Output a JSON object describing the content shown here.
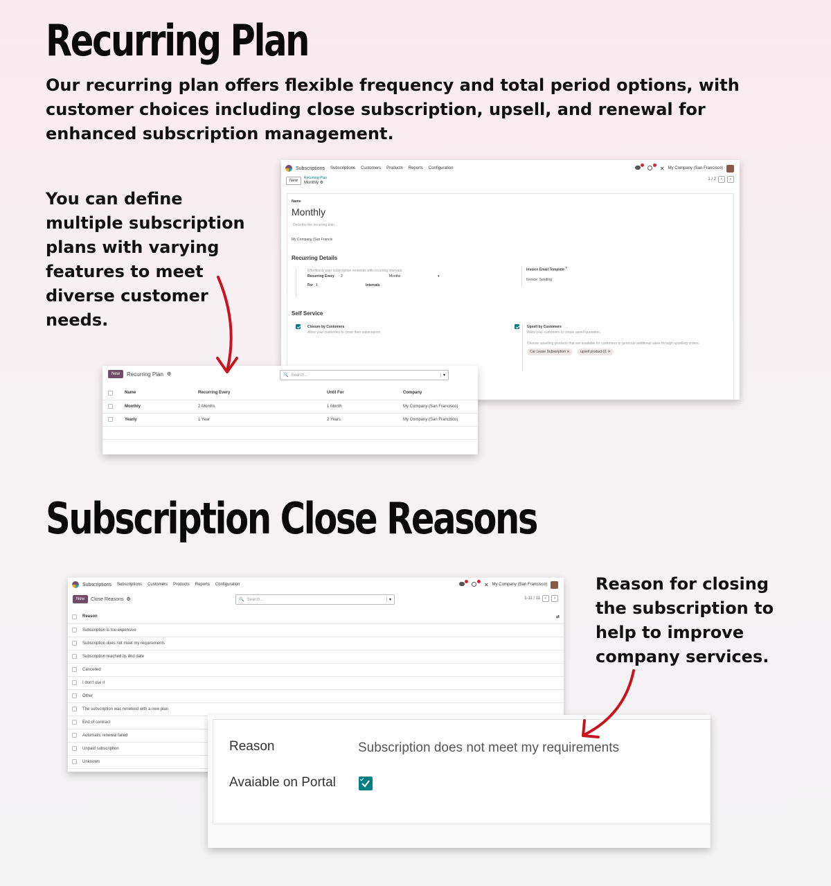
{
  "section1": {
    "title": "Recurring Plan",
    "description": "Our recurring plan offers flexible frequency and total period options, with customer choices including close subscription, upsell, and renewal for enhanced subscription management.",
    "side_text": "You can define multiple subscription plans with varying features to meet diverse customer needs."
  },
  "form_shot": {
    "app": "Subscriptions",
    "menus": [
      "Subscriptions",
      "Customers",
      "Products",
      "Reports",
      "Configuration"
    ],
    "company": "My Company (San Francisco)",
    "new_label": "New",
    "breadcrumb_parent": "Recurring Plan",
    "breadcrumb_current": "Monthly",
    "pager": "1 / 2",
    "name_label": "Name",
    "name_value": "Monthly",
    "description_placeholder": "Describe the recurring plan...",
    "company_value": "My Company (San Francis",
    "recurring_details_title": "Recurring Details",
    "recurring_help": "Effortlessly plan subscription renewals with recurring intervals.",
    "recurring_every_label": "Recurring Every",
    "recurring_every_value": "2",
    "recurring_every_unit": "Months",
    "for_label": "For",
    "for_value": "1",
    "for_unit": "Intervals",
    "invoice_template_label": "Invoice Email Template",
    "invoice_template_value": "Invoice: Sending",
    "self_service_title": "Self Service",
    "closure_label": "Closure by Customers",
    "closure_help": "Allow your customers to close their subscription.",
    "upsell_label": "Upsell by Customers",
    "upsell_help": "Allow your customers to create upsell quotation.",
    "upsell_products_help": "Choose upselling products that are available for customers to generate additional sales through upselling orders.",
    "tags": [
      "Car Lease Subscription ✕",
      "upsell product 01 ✕"
    ]
  },
  "plan_list": {
    "new_label": "New",
    "title": "Recurring Plan",
    "search_placeholder": "Search...",
    "headers": [
      "Name",
      "Recurring Every",
      "Until For",
      "Company"
    ],
    "rows": [
      [
        "Monthly",
        "2 Months",
        "1 Month",
        "My Company (San Francisco)"
      ],
      [
        "Yearly",
        "1 Year",
        "2 Years",
        "My Company (San Francisco)"
      ]
    ]
  },
  "section2": {
    "title": "Subscription Close Reasons",
    "side_text": "Reason for closing the subscription to help to improve company services."
  },
  "reasons_shot": {
    "app": "Subscriptions",
    "menus": [
      "Subscriptions",
      "Customers",
      "Products",
      "Reports",
      "Configuration"
    ],
    "company": "My Company (San Francisco)",
    "new_label": "New",
    "title": "Close Reasons",
    "search_placeholder": "Search...",
    "pager": "1-11 / 11",
    "column": "Reason",
    "rows": [
      "Subscription is too expensive",
      "Subscription does not meet my requirements",
      "Subscription reached its end date",
      "Cancelled",
      "I don't use it",
      "Other",
      "The subscription was renewed with a new plan",
      "End of contract",
      "Automatic renewal failed",
      "Unpaid subscription",
      "Unknown"
    ]
  },
  "reason_detail": {
    "reason_label": "Reason",
    "reason_value": "Subscription does not meet my requirements",
    "portal_label": "Avaiable on Portal",
    "portal_checked": true
  },
  "colors": {
    "brand": "#714b67",
    "check": "#017e84",
    "arrow": "#c8141e"
  }
}
